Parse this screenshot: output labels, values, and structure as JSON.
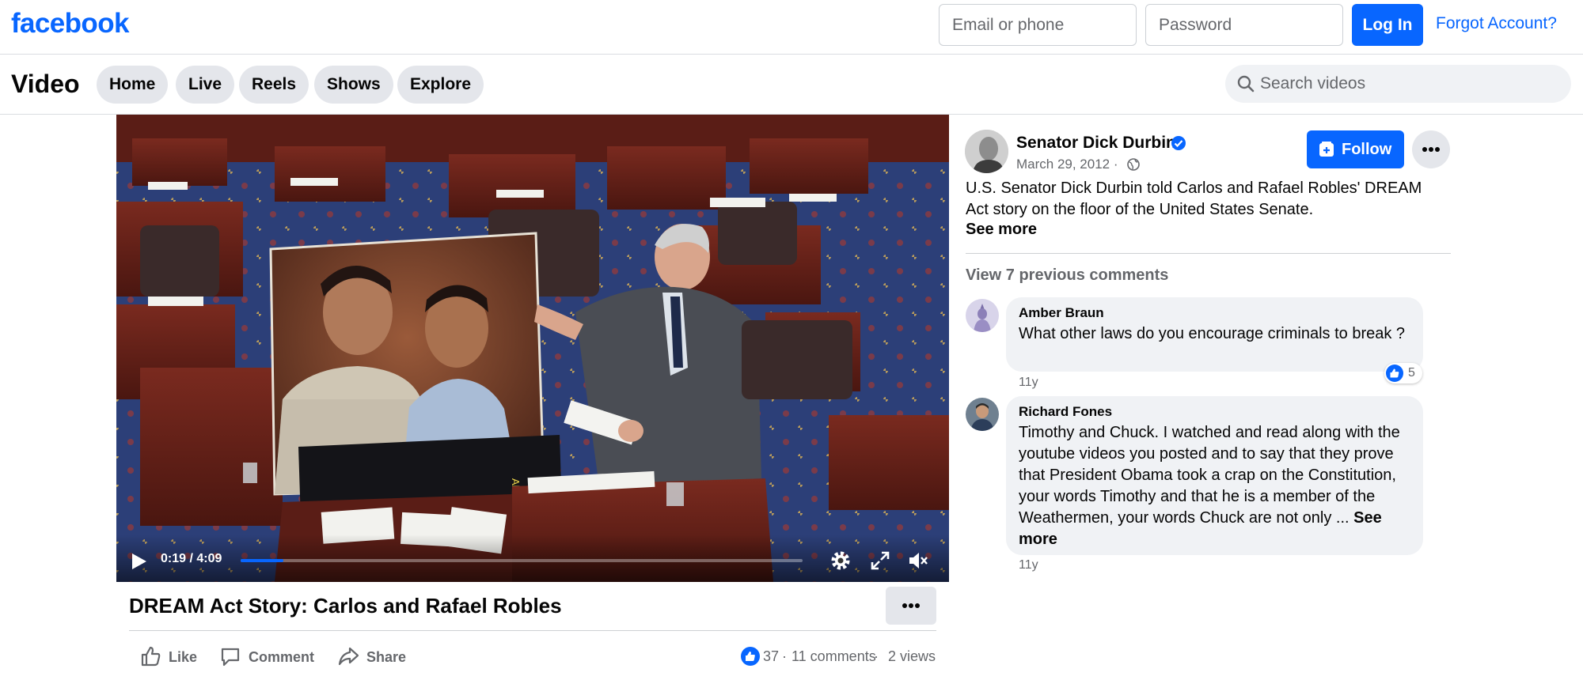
{
  "header": {
    "logo": "facebook",
    "email_placeholder": "Email or phone",
    "password_placeholder": "Password",
    "login_label": "Log In",
    "forgot_label": "Forgot Account?"
  },
  "video_nav": {
    "title": "Video",
    "tabs": [
      {
        "label": "Home"
      },
      {
        "label": "Live"
      },
      {
        "label": "Reels"
      },
      {
        "label": "Shows"
      },
      {
        "label": "Explore"
      }
    ],
    "search_placeholder": "Search videos"
  },
  "player": {
    "time": "0:19 / 4:09",
    "progress": 0.076
  },
  "video": {
    "title": "DREAM Act Story: Carlos and Rafael Robles",
    "actions": [
      {
        "label": "Like"
      },
      {
        "label": "Comment"
      },
      {
        "label": "Share"
      }
    ],
    "reactions_count": "37",
    "comments_count": "11 comments",
    "views": "2 views",
    "sep": "·"
  },
  "post": {
    "author": "Senator Dick Durbin",
    "date": "March 29, 2012 ·",
    "follow_label": "Follow",
    "description": "U.S. Senator Dick Durbin told Carlos and Rafael Robles' DREAM Act story on the floor of the United States Senate.",
    "see_more": "See more",
    "view_previous": "View 7 previous comments"
  },
  "comments": [
    {
      "author": "Amber Braun",
      "text": "What other laws do you encourage criminals to break ?",
      "time": "11y",
      "reactions": "5"
    },
    {
      "author": "Richard Fones",
      "text": "Timothy and Chuck. I watched and read along with the youtube videos you posted and to say that they prove that President Obama took a crap on the Constitution, your words Timothy and that he is a member of the Weathermen, your words Chuck are not only ...",
      "see_more": "See more",
      "time": "11y"
    }
  ],
  "colors": {
    "brand_blue": "#0866ff",
    "secondary_text": "#65676b",
    "bubble_bg": "#f0f2f5"
  },
  "icons": [
    "search-icon",
    "play-icon",
    "settings-icon",
    "fullscreen-icon",
    "mute-icon",
    "like-icon",
    "comment-icon",
    "share-icon",
    "verified-icon",
    "globe-icon",
    "follow-icon",
    "more-icon"
  ]
}
